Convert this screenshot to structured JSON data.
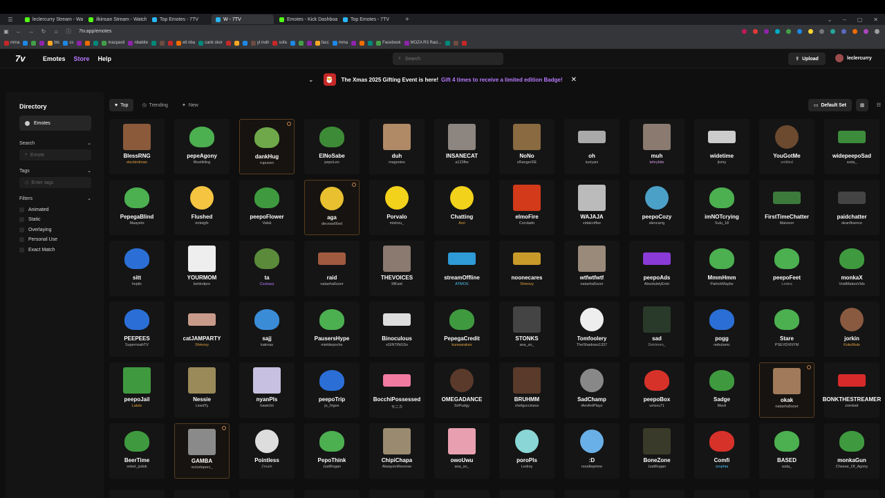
{
  "browser": {
    "tabs": [
      {
        "label": "leclercurry Stream - Watch",
        "icon": "kick",
        "active": false
      },
      {
        "label": "ilkinsan Stream - Watch Liv",
        "icon": "kick",
        "active": false
      },
      {
        "label": "Top Emotes - 7TV",
        "icon": "seven",
        "active": false
      },
      {
        "label": "W - 7TV",
        "icon": "seven",
        "active": true
      },
      {
        "label": "Emotes - Kick Dashboard",
        "icon": "kick",
        "active": false
      },
      {
        "label": "Top Emotes - 7TV",
        "icon": "seven",
        "active": false
      }
    ],
    "url": "7tv.app/emotes",
    "bookmarks": [
      "mma",
      "btc",
      "cs",
      "macpasti",
      "nbabite",
      "elt nba",
      "cank skor",
      "yt indir",
      "sofa",
      "facc",
      "mma",
      "Facebook",
      "MOZA R3 Raci..."
    ]
  },
  "header": {
    "logo": "7v",
    "nav": {
      "emotes": "Emotes",
      "store": "Store",
      "help": "Help"
    },
    "search_placeholder": "Search",
    "upload_label": "Upload",
    "username": "leclercurry"
  },
  "banner": {
    "text": "The Xmas 2025 Gifting Event is here!",
    "link": "Gift 4 times to receive a limited edition Badge!",
    "gift_icon": "🎅"
  },
  "sidebar": {
    "title": "Directory",
    "active_item": "Emotes",
    "search_label": "Search",
    "search_placeholder": "Emote",
    "tags_label": "Tags",
    "tags_placeholder": "Enter tags",
    "filters_label": "Filters",
    "filters": [
      "Animated",
      "Static",
      "Overlaying",
      "Personal Use",
      "Exact Match"
    ]
  },
  "main": {
    "sort_tabs": [
      "Top",
      "Trending",
      "New"
    ],
    "active_sort": "Top",
    "set_label": "Default Set"
  },
  "emotes": [
    {
      "name": "BlessRNG",
      "owner": "elecbirdman",
      "color": "#8a5a3a",
      "shape": "rect",
      "owner_color": "#e6a23c"
    },
    {
      "name": "pepeAgony",
      "owner": "Mustikling",
      "color": "#4caf50",
      "shape": "frog"
    },
    {
      "name": "dankHug",
      "owner": "rupusen",
      "color": "#6fa84a",
      "shape": "frog",
      "selected": true
    },
    {
      "name": "ElNoSabe",
      "owner": "pepoLeo",
      "color": "#3d8b37",
      "shape": "frog"
    },
    {
      "name": "duh",
      "owner": "magooies",
      "color": "#b08a66",
      "shape": "rect"
    },
    {
      "name": "INSANECAT",
      "owner": "a123ftw",
      "color": "#8c8580",
      "shape": "rect"
    },
    {
      "name": "NoNo",
      "owner": "xRangerDE",
      "color": "#8a6a40",
      "shape": "rect"
    },
    {
      "name": "oh",
      "owner": "kuriyani",
      "color": "#aaaaaa",
      "shape": "wide"
    },
    {
      "name": "muh",
      "owner": "tehrybite",
      "color": "#8a7a70",
      "shape": "rect",
      "owner_color": "#d99ae6"
    },
    {
      "name": "widetime",
      "owner": "jivmy",
      "color": "#cccccc",
      "shape": "wide"
    },
    {
      "name": "YouGotMe",
      "owner": "untitled",
      "color": "#6b4a30",
      "shape": "round",
      "owner_color": "#999"
    },
    {
      "name": "widepeepoSad",
      "owner": "soda_",
      "color": "#3c8c3c",
      "shape": "wide"
    },
    {
      "name": "PepegaBlind",
      "owner": "Maayeto",
      "color": "#4caf50",
      "shape": "frog"
    },
    {
      "name": "Flushed",
      "owner": "enteigfx",
      "color": "#f5c542",
      "shape": "round"
    },
    {
      "name": "peepoFlower",
      "owner": "Valsk",
      "color": "#3f9a3f",
      "shape": "frog"
    },
    {
      "name": "aga",
      "owner": "deceas66ed",
      "color": "#e8c030",
      "shape": "round",
      "selected": true
    },
    {
      "name": "Porvalo",
      "owner": "mistrzu_",
      "color": "#f2d21b",
      "shape": "round"
    },
    {
      "name": "Chatting",
      "owner": "Axri",
      "color": "#f2d21b",
      "shape": "round",
      "owner_color": "#e6a23c"
    },
    {
      "name": "elmoFire",
      "owner": "Corolado",
      "color": "#d23a1a",
      "shape": "rect"
    },
    {
      "name": "WAJAJA",
      "owner": "vidalcoffee",
      "color": "#bbbbbb",
      "shape": "rect"
    },
    {
      "name": "peepoCozy",
      "owner": "alencarrg",
      "color": "#4ba0c8",
      "shape": "round"
    },
    {
      "name": "imNOTcrying",
      "owner": "Sulu_18",
      "color": "#4caf50",
      "shape": "frog"
    },
    {
      "name": "FirstTimeChatter",
      "owner": "Maiveon",
      "color": "#3c7a3c",
      "shape": "wide"
    },
    {
      "name": "paidchatter",
      "owner": "deanfluence",
      "color": "#444444",
      "shape": "wide"
    },
    {
      "name": "sitt",
      "owner": "hvptic",
      "color": "#2b6fd6",
      "shape": "frog"
    },
    {
      "name": "YOURMOM",
      "owner": "behindpro",
      "color": "#eeeeee",
      "shape": "rect"
    },
    {
      "name": "ta",
      "owner": "Czukasz",
      "color": "#5a8a3a",
      "shape": "frog",
      "owner_color": "#b87bff"
    },
    {
      "name": "raid",
      "owner": "natasha5ozer",
      "color": "#a05a40",
      "shape": "wide"
    },
    {
      "name": "THEVOICES",
      "owner": "MKaid",
      "color": "#8a7a70",
      "shape": "rect"
    },
    {
      "name": "streamOffline",
      "owner": "ATMOS",
      "color": "#2e9ad6",
      "shape": "wide",
      "owner_color": "#4fc3f7"
    },
    {
      "name": "noonecares",
      "owner": "Shmovy",
      "color": "#c89a2a",
      "shape": "wide",
      "owner_color": "#e6a23c"
    },
    {
      "name": "wtfwtfwtf",
      "owner": "natasha5ozer",
      "color": "#9a8a7a",
      "shape": "rect"
    },
    {
      "name": "peepoAds",
      "owner": "AbsolutelyEmir",
      "color": "#8a3ad6",
      "shape": "wide"
    },
    {
      "name": "MmmHmm",
      "owner": "PatrickMaybe",
      "color": "#4caf50",
      "shape": "frog"
    },
    {
      "name": "peepoFeet",
      "owner": "Ledea",
      "color": "#4caf50",
      "shape": "frog",
      "owner_color": "#999"
    },
    {
      "name": "monkaX",
      "owner": "VoidMakesVids",
      "color": "#3f9a3f",
      "shape": "frog"
    },
    {
      "name": "PEEPEES",
      "owner": "SupernoahTV",
      "color": "#2b6fd6",
      "shape": "frog"
    },
    {
      "name": "catJAMPARTY",
      "owner": "Shmovy",
      "color": "#c89a8a",
      "shape": "wide",
      "owner_color": "#e6a23c"
    },
    {
      "name": "sajj",
      "owner": "katrnas",
      "color": "#3a8cd6",
      "shape": "frog"
    },
    {
      "name": "PausersHype",
      "owner": "mieldepoche",
      "color": "#4caf50",
      "shape": "frog"
    },
    {
      "name": "Binoculous",
      "owner": "xGINTINGSx",
      "color": "#dddddd",
      "shape": "wide"
    },
    {
      "name": "PepegaCredit",
      "owner": "kunwarakes",
      "color": "#3f9a3f",
      "shape": "frog",
      "owner_color": "#e6a23c"
    },
    {
      "name": "STONKS",
      "owner": "ana_so_",
      "color": "#444444",
      "shape": "rect"
    },
    {
      "name": "Tomfoolery",
      "owner": "TheShadows1337",
      "color": "#eeeeee",
      "shape": "round"
    },
    {
      "name": "sad",
      "owner": "Detrimen_",
      "color": "#2a3a2a",
      "shape": "rect",
      "owner_color": "#999"
    },
    {
      "name": "pogg",
      "owner": "nebulamc",
      "color": "#2b6fd6",
      "shape": "frog"
    },
    {
      "name": "Stare",
      "owner": "PSEVDXNYM",
      "color": "#4caf50",
      "shape": "frog"
    },
    {
      "name": "jorkin",
      "owner": "KokoNuts",
      "color": "#8a5a40",
      "shape": "round",
      "owner_color": "#e6a23c"
    },
    {
      "name": "peepoJail",
      "owner": "Latzie",
      "color": "#3f9a3f",
      "shape": "rect",
      "owner_color": "#e6a23c"
    },
    {
      "name": "Nessie",
      "owner": "LewdTy",
      "color": "#9a8a5a",
      "shape": "rect"
    },
    {
      "name": "nyanPls",
      "owner": "hawichii",
      "color": "#c8c0e0",
      "shape": "rect"
    },
    {
      "name": "peepoTrip",
      "owner": "jo_0rgee",
      "color": "#2b6fd6",
      "shape": "frog"
    },
    {
      "name": "BocchiPossessed",
      "owner": "モニカ",
      "color": "#f07aa0",
      "shape": "wide"
    },
    {
      "name": "OMEGADANCE",
      "owner": "SirPudgy",
      "color": "#5a3a2a",
      "shape": "round"
    },
    {
      "name": "BRUHMM",
      "owner": "chefgucciness",
      "color": "#5a3a2a",
      "shape": "rect"
    },
    {
      "name": "SadChamp",
      "owner": "iAmAntPlayz",
      "color": "#888888",
      "shape": "round"
    },
    {
      "name": "peepoBox",
      "owner": "umsru71",
      "color": "#d6322a",
      "shape": "frog"
    },
    {
      "name": "Sadge",
      "owner": "Mavli",
      "color": "#3f9a3f",
      "shape": "frog"
    },
    {
      "name": "okak",
      "owner": "natasha5ozer",
      "color": "#a07a5a",
      "shape": "rect",
      "selected": true
    },
    {
      "name": "BONKTHESTREAMER",
      "owner": "zombalr",
      "color": "#d62a2a",
      "shape": "wide"
    },
    {
      "name": "BeerTime",
      "owner": "onkel_jodok",
      "color": "#3f9a3f",
      "shape": "frog"
    },
    {
      "name": "GAMBA",
      "owner": "victorleporc_",
      "color": "#8a8a8a",
      "shape": "rect",
      "selected": true
    },
    {
      "name": "Pointless",
      "owner": "Zmark",
      "color": "#dddddd",
      "shape": "round",
      "owner_color": "#999"
    },
    {
      "name": "PepoThink",
      "owner": "JustRogan",
      "color": "#4caf50",
      "shape": "frog"
    },
    {
      "name": "ChipiChapa",
      "owner": "AlwaysInReverse",
      "color": "#9a8a70",
      "shape": "rect"
    },
    {
      "name": "owoUwu",
      "owner": "ana_so_",
      "color": "#e8a0b0",
      "shape": "rect"
    },
    {
      "name": "poroPls",
      "owner": "Ledroy",
      "color": "#8ad6d6",
      "shape": "round"
    },
    {
      "name": ":D",
      "owner": "noodleprime",
      "color": "#6ab0e8",
      "shape": "round"
    },
    {
      "name": "BoneZone",
      "owner": "JustRogan",
      "color": "#3a3a2a",
      "shape": "rect"
    },
    {
      "name": "Comfi",
      "owner": "orophia",
      "color": "#d6322a",
      "shape": "frog",
      "owner_color": "#4fc3f7"
    },
    {
      "name": "BASED",
      "owner": "soda_",
      "color": "#4caf50",
      "shape": "frog"
    },
    {
      "name": "monkaGun",
      "owner": "Cheese_Of_Agony",
      "color": "#3f9a3f",
      "shape": "frog"
    }
  ]
}
